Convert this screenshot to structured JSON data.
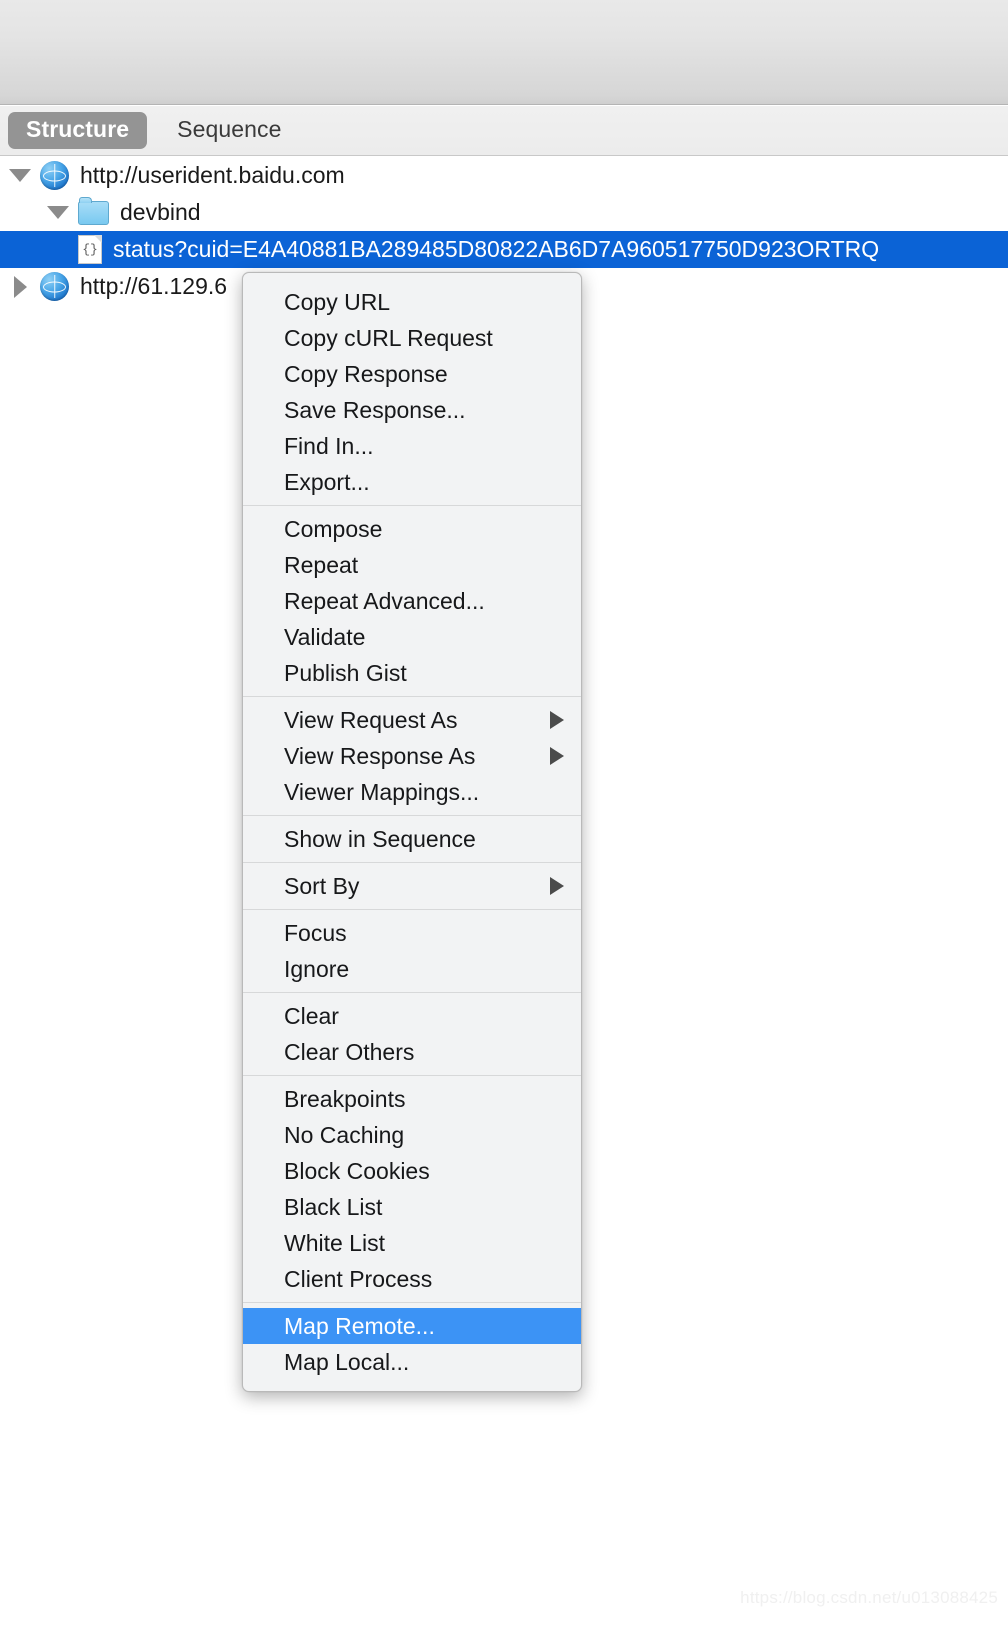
{
  "toolbar": {
    "empty": ""
  },
  "tabs": [
    {
      "label": "Structure",
      "active": true
    },
    {
      "label": "Sequence",
      "active": false
    }
  ],
  "tree": [
    {
      "label": "http://userident.baidu.com",
      "icon": "globe-icon",
      "expanded": true,
      "indent": 0,
      "selected": false
    },
    {
      "label": "devbind",
      "icon": "folder-icon",
      "expanded": true,
      "indent": 1,
      "selected": false
    },
    {
      "label": "status?cuid=E4A40881BA289485D80822AB6D7A960517750D923ORTRQ",
      "icon": "json-file-icon",
      "icon_glyph": "{}",
      "indent": 2,
      "selected": true
    },
    {
      "label": "http://61.129.6",
      "icon": "globe-icon",
      "expanded": false,
      "indent": 0,
      "selected": false
    }
  ],
  "context_menu": {
    "highlight_color": "#3c93f5",
    "groups": [
      {
        "items": [
          {
            "label": "Copy URL",
            "submenu": false
          },
          {
            "label": "Copy cURL Request",
            "submenu": false
          },
          {
            "label": "Copy Response",
            "submenu": false
          },
          {
            "label": "Save Response...",
            "submenu": false
          },
          {
            "label": "Find In...",
            "submenu": false
          },
          {
            "label": "Export...",
            "submenu": false
          }
        ]
      },
      {
        "items": [
          {
            "label": "Compose",
            "submenu": false
          },
          {
            "label": "Repeat",
            "submenu": false
          },
          {
            "label": "Repeat Advanced...",
            "submenu": false
          },
          {
            "label": "Validate",
            "submenu": false
          },
          {
            "label": "Publish Gist",
            "submenu": false
          }
        ]
      },
      {
        "items": [
          {
            "label": "View Request As",
            "submenu": true
          },
          {
            "label": "View Response As",
            "submenu": true
          },
          {
            "label": "Viewer Mappings...",
            "submenu": false
          }
        ]
      },
      {
        "items": [
          {
            "label": "Show in Sequence",
            "submenu": false
          }
        ]
      },
      {
        "items": [
          {
            "label": "Sort By",
            "submenu": true
          }
        ]
      },
      {
        "items": [
          {
            "label": "Focus",
            "submenu": false
          },
          {
            "label": "Ignore",
            "submenu": false
          }
        ]
      },
      {
        "items": [
          {
            "label": "Clear",
            "submenu": false
          },
          {
            "label": "Clear Others",
            "submenu": false
          }
        ]
      },
      {
        "items": [
          {
            "label": "Breakpoints",
            "submenu": false
          },
          {
            "label": "No Caching",
            "submenu": false
          },
          {
            "label": "Block Cookies",
            "submenu": false
          },
          {
            "label": "Black List",
            "submenu": false
          },
          {
            "label": "White List",
            "submenu": false
          },
          {
            "label": "Client Process",
            "submenu": false
          }
        ]
      },
      {
        "items": [
          {
            "label": "Map Remote...",
            "submenu": false,
            "highlighted": true
          },
          {
            "label": "Map Local...",
            "submenu": false
          }
        ]
      }
    ]
  },
  "watermark": {
    "text": "https://blog.csdn.net/u013088425"
  }
}
